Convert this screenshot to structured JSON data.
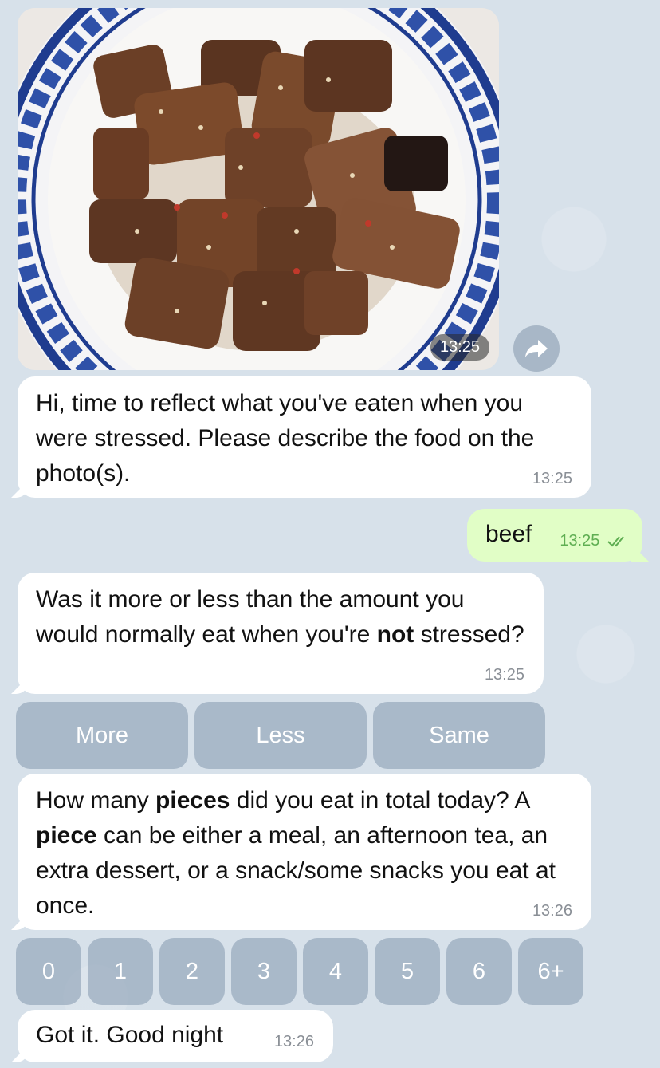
{
  "photo": {
    "time": "13:25"
  },
  "messages": {
    "m1": {
      "text": "Hi, time to reflect what you've eaten when you were stressed. Please describe the food on the photo(s).",
      "time": "13:25"
    },
    "m2": {
      "text": "beef",
      "time": "13:25"
    },
    "m3": {
      "text_a": "Was it more or less than the amount you would normally eat when you're ",
      "text_bold": "not",
      "text_b": " stressed?",
      "time": "13:25"
    },
    "m4": {
      "t1": "How many ",
      "b1": "pieces",
      "t2": " did you eat in total today? A ",
      "b2": "piece",
      "t3": " can be either a meal, an afternoon tea, an extra dessert, or a snack/some snacks you eat at once.",
      "time": "13:26"
    },
    "m5": {
      "text": "Got it. Good night",
      "time": "13:26"
    }
  },
  "keyboard1": {
    "options": [
      "More",
      "Less",
      "Same"
    ]
  },
  "keyboard2": {
    "options": [
      "0",
      "1",
      "2",
      "3",
      "4",
      "5",
      "6",
      "6+"
    ]
  },
  "icons": {
    "forward": "forward-arrow-icon",
    "read": "double-check-icon"
  }
}
